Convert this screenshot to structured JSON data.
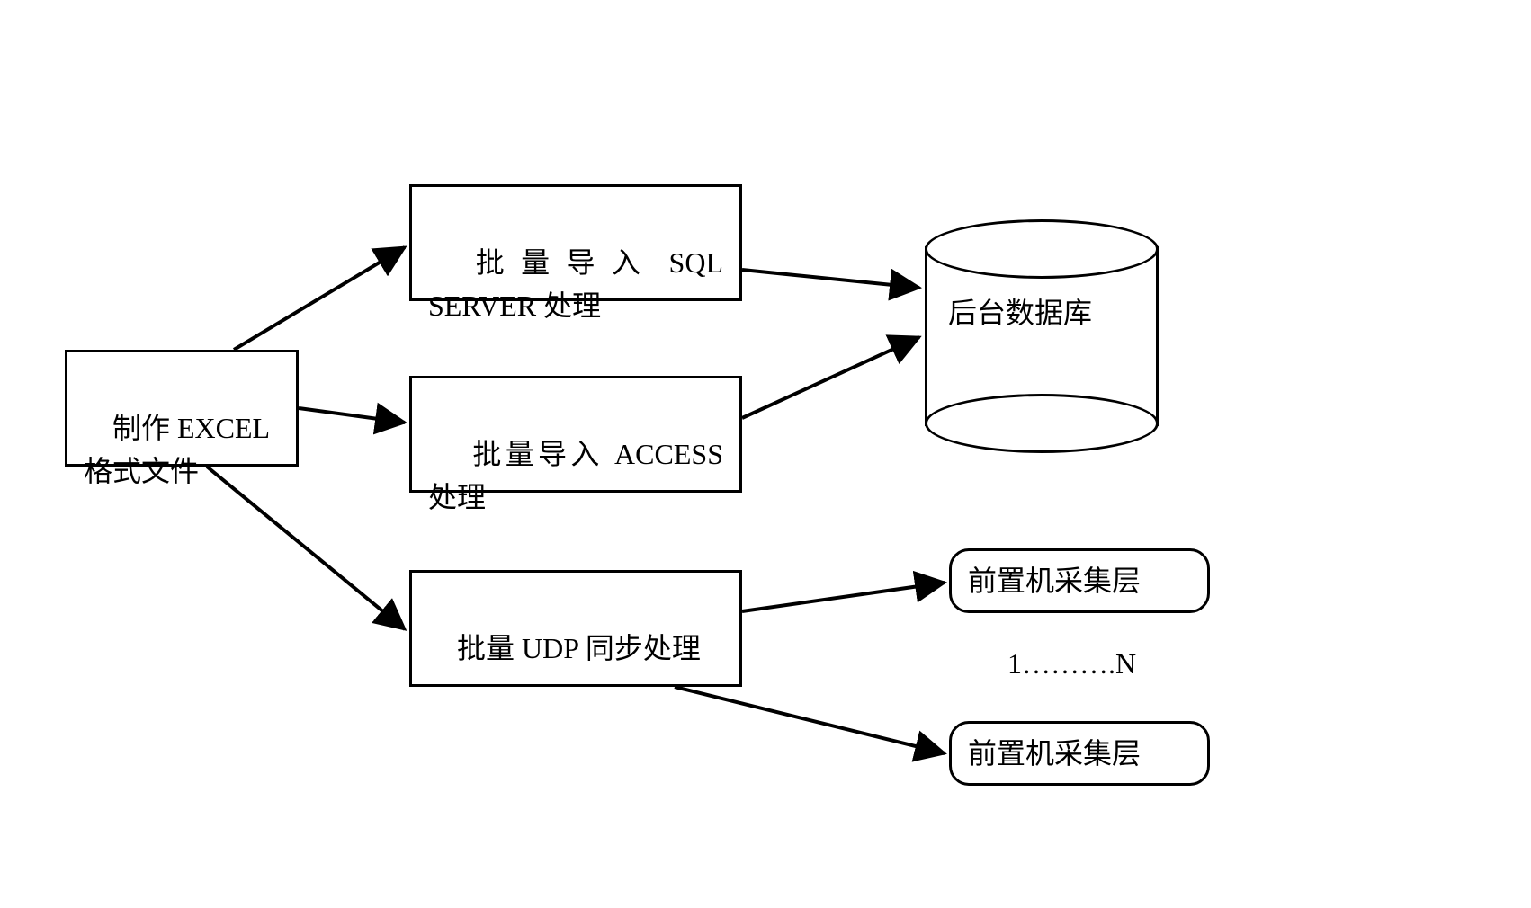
{
  "source": {
    "label": "制作 EXCEL\n格式文件"
  },
  "processors": {
    "sql": {
      "label": "批 量 导 入  SQL SERVER 处理"
    },
    "access": {
      "label": "批量导入 ACCESS 处理"
    },
    "udp": {
      "label": "批量 UDP 同步处理"
    }
  },
  "targets": {
    "db": {
      "label": "后台数据库"
    },
    "frontend1": {
      "label": "前置机采集层"
    },
    "frontendN": {
      "label": "前置机采集层"
    },
    "range": {
      "label": "1……….N"
    }
  }
}
